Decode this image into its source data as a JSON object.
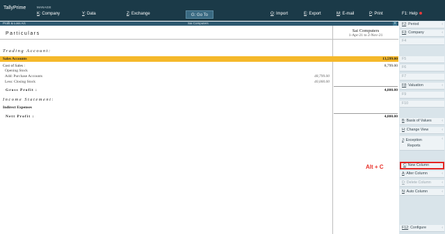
{
  "topbar": {
    "logo": "TallyPrime",
    "manage": "MANAGE",
    "company": {
      "key": "K",
      "rest": ": Company"
    },
    "data": {
      "key": "Y",
      "rest": ": Data"
    },
    "exchange": {
      "key": "Z",
      "rest": ": Exchange"
    },
    "goto": "G: Go To",
    "import": {
      "key": "O",
      "rest": ": Import"
    },
    "export": {
      "key": "E",
      "rest": ": Export"
    },
    "email": {
      "key": "M",
      "rest": ": E-mail"
    },
    "print": {
      "key": "P",
      "rest": ": Print"
    },
    "help": "F1: Help"
  },
  "titlestrip": {
    "left": "Profit & Loss A/c",
    "center": "Sai Computers",
    "close": "×"
  },
  "report": {
    "particulars": "Particulars",
    "column_title": "Sai Computers",
    "column_period": "1-Apr-21 to 2-Nov-21",
    "trading_account": "Trading Account:",
    "sales_accounts": "Sales Accounts",
    "sales_amount": "13,599.00",
    "cost_of_sales": "Cost of Sales :",
    "cost_of_sales_amount": "8,799.00",
    "opening_stock": "Opening Stock",
    "add_purchase": "Add: Purchase Accounts",
    "add_purchase_amount": "48,799.00",
    "less_closing": "Less: Closing Stock",
    "less_closing_amount": "40,000.00",
    "gross_profit": "Gross Profit   :",
    "gross_profit_amount": "4,800.00",
    "income_statement": "Income Statement:",
    "indirect_expenses": "Indirect Expenses",
    "nett_profit": "Nett Profit   :",
    "nett_profit_amount": "4,800.00"
  },
  "annotation": "Alt + C",
  "rightbar": {
    "period": {
      "key": "F2",
      "rest": ": Period"
    },
    "company": {
      "key": "F3",
      "rest": ": Company"
    },
    "f4": "F4",
    "f5": "F5",
    "f6": "F6",
    "f7": "F7",
    "valuation": {
      "key": "F8",
      "rest": ": Valuation"
    },
    "f9": "F9",
    "f10": "F10",
    "basis": {
      "key": "B",
      "rest": ": Basis of Values"
    },
    "change_view": {
      "key": "H",
      "rest": ": Change View"
    },
    "exception": {
      "key": "J",
      "rest": ": Exception"
    },
    "exception_2": "Reports",
    "new_column": {
      "key": "C",
      "rest": ": New Column"
    },
    "alter_column": {
      "key": "A",
      "rest": ": Alter Column"
    },
    "delete_column": {
      "key": "D",
      "rest": ": Delete Column"
    },
    "auto_column": {
      "key": "N",
      "rest": ": Auto Column"
    },
    "configure": {
      "key": "F12",
      "rest": ": Configure"
    }
  },
  "colors": {
    "topbar": "#1b3a48",
    "sales_highlight": "#f5b82a",
    "annotation": "#e8312a"
  }
}
